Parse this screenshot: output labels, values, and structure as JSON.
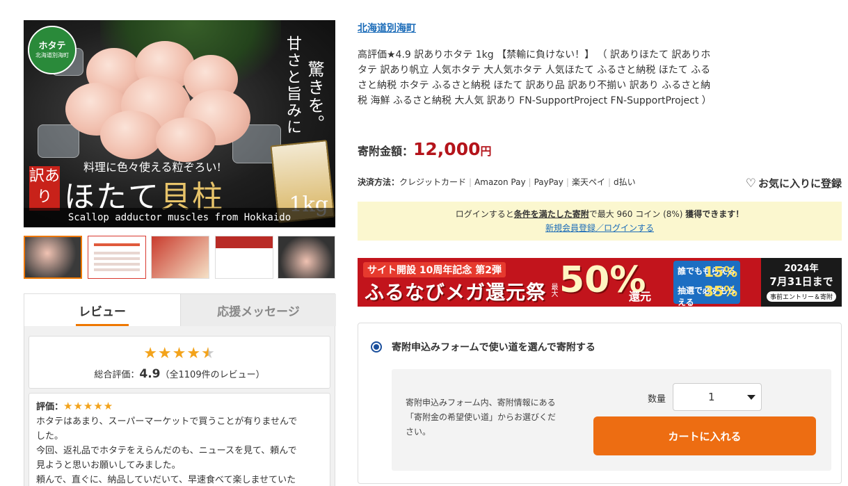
{
  "gallery": {
    "main_image": {
      "badge": "ホタテ",
      "badge_sub": "北海道別海町",
      "vertical_1": "甘さと旨みに",
      "vertical_2": "驚きを。",
      "catch": "料理に色々使える粒ぞろい!",
      "wake": "訳あり",
      "title_1": "ほたて",
      "title_2": "貝柱",
      "weight": "1kg",
      "caption": "Scallop adductor muscles from Hokkaido"
    },
    "thumbnails": [
      "thumb-1",
      "thumb-2",
      "thumb-3",
      "thumb-4",
      "thumb-5"
    ]
  },
  "review_tabs": {
    "tab_review": "レビュー",
    "tab_support": "応援メッセージ"
  },
  "review_summary": {
    "rating_stars": 4.5,
    "prefix": "総合評価：",
    "score": "4.9",
    "count_text": "（全1109件のレビュー）"
  },
  "review": {
    "label": "評価：",
    "stars": 5,
    "lines": [
      "ホタテはあまり、スーパーマーケットで買うことが有りませんで",
      "した。",
      "今回、返礼品でホタテをえらんだのも、ニュースを見て、頼んで",
      "見ようと思いお願いしてみました。",
      "頼んで、直ぐに、納品していだいて、早速食べて楽しませていた"
    ]
  },
  "product": {
    "town": "北海道別海町",
    "title": "高評価★4.9 訳ありホタテ 1kg 【禁輸に負けない！】 （ 訳ありほたて 訳ありホタテ 訳あり帆立 人気ホタテ 大人気ホタテ 人気ほたて ふるさと納税 ほたて ふるさと納税 ホタテ ふるさと納税 ほたて 訳あり品 訳あり不揃い 訳あり ふるさと納税 海鮮 ふるさと納税 大人気 訳あり FN-SupportProject FN-SupportProject ）",
    "price_label": "寄附金額：",
    "price": "12,000",
    "yen": "円"
  },
  "payment": {
    "label": "決済方法：",
    "methods": [
      "クレジットカード",
      "Amazon Pay",
      "PayPay",
      "楽天ペイ",
      "d払い"
    ]
  },
  "favorite_label": "お気に入りに登録",
  "notice": {
    "pre": "ログインすると",
    "condition_link": "条件を満たした寄附",
    "mid": "で最大 960 コイン (8%) ",
    "get": "獲得できます！",
    "login_link": "新規会員登録／ログインする"
  },
  "banner": {
    "line1": "サイト開設 10周年記念 第2弾",
    "line2": "ふるなびメガ還元祭",
    "max": "最大",
    "percent": "50%",
    "kangen": "還元",
    "blue_row1": "誰でももらえる",
    "blue_row2": "抽選で必ずもらえる",
    "blue_pct1": "15%",
    "blue_pct2": "35%",
    "date_year": "2024年",
    "date_day": "7月31日まで",
    "entry": "事前エントリー＆寄附"
  },
  "donation_form": {
    "option_label": "寄附申込みフォームで使い道を選んで寄附する",
    "description": "寄附申込みフォーム内、寄附情報にある「寄附金の希望使い道」からお選びください。",
    "quantity_label": "数量",
    "quantity_value": "1",
    "cart_button": "カートに入れる"
  },
  "colors": {
    "accent_orange": "#ed6d12",
    "price_red": "#b4141b",
    "link_blue": "#1a6bb8",
    "star": "#f3a31b"
  }
}
